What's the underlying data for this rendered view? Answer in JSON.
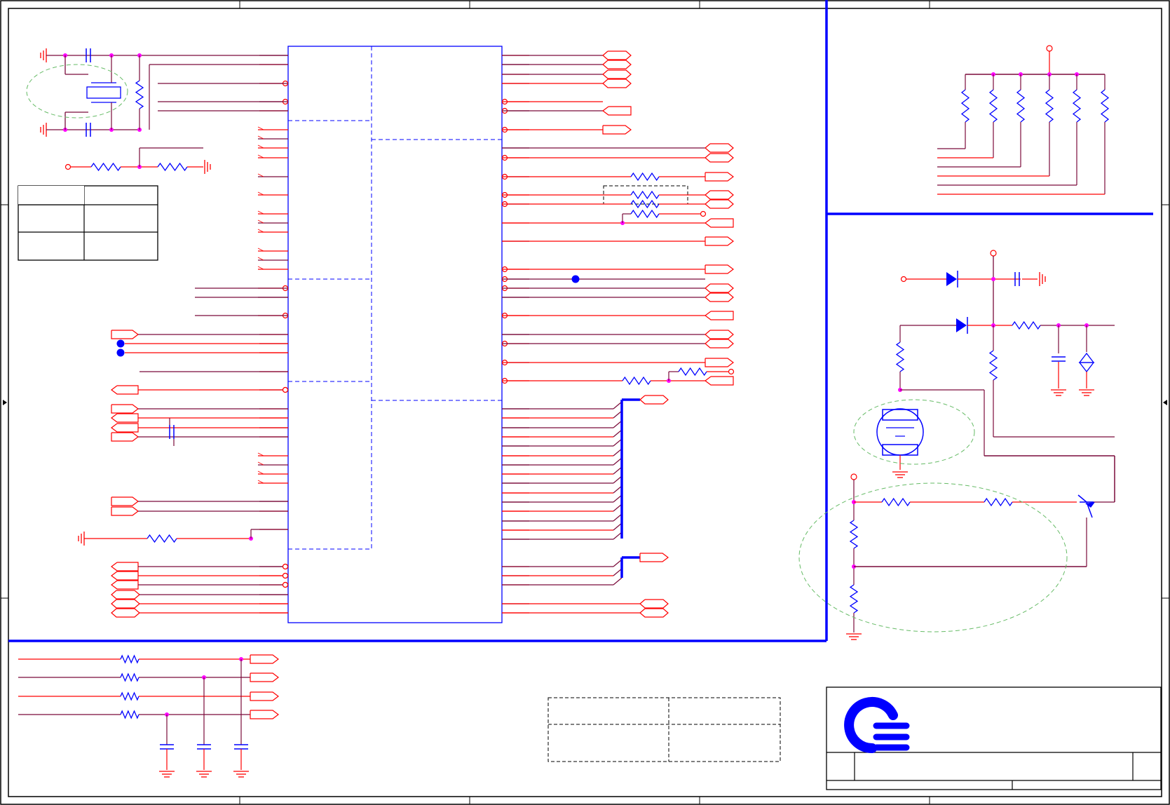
{
  "colors": {
    "border": "#000000",
    "wire": "#7a0a3a",
    "wire_red": "#ff0000",
    "component": "#0000ff",
    "bus": "#0000ff",
    "junction": "#ff00ff",
    "annotation": "#66bb66",
    "logo": "#0000ff",
    "background": "#ffffff"
  },
  "icons": {
    "logo": "company-logo-icon",
    "ground": "ground-icon",
    "resistor": "resistor-icon",
    "capacitor": "capacitor-icon",
    "diode": "diode-icon",
    "crystal": "crystal-icon",
    "transistor": "transistor-icon",
    "offpage_connector": "offpage-connector-icon"
  }
}
